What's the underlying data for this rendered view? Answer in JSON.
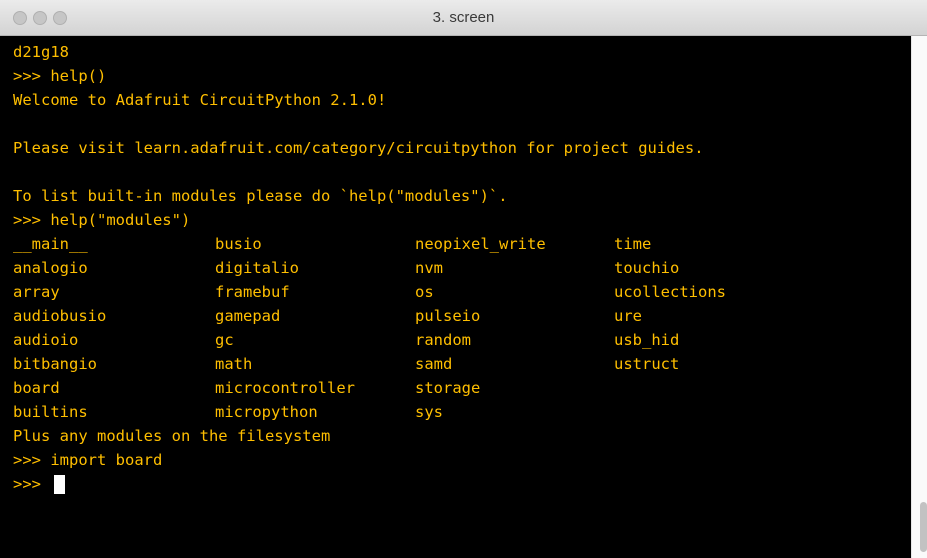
{
  "window": {
    "title": "3. screen"
  },
  "terminal": {
    "lines_top": [
      "d21g18",
      ">>> help()",
      "Welcome to Adafruit CircuitPython 2.1.0!",
      "",
      "Please visit learn.adafruit.com/category/circuitpython for project guides.",
      "",
      "To list built-in modules please do `help(\"modules\")`.",
      ">>> help(\"modules\")"
    ],
    "modules": [
      [
        "__main__",
        "busio",
        "neopixel_write",
        "time"
      ],
      [
        "analogio",
        "digitalio",
        "nvm",
        "touchio"
      ],
      [
        "array",
        "framebuf",
        "os",
        "ucollections"
      ],
      [
        "audiobusio",
        "gamepad",
        "pulseio",
        "ure"
      ],
      [
        "audioio",
        "gc",
        "random",
        "usb_hid"
      ],
      [
        "bitbangio",
        "math",
        "samd",
        "ustruct"
      ],
      [
        "board",
        "microcontroller",
        "storage",
        ""
      ],
      [
        "builtins",
        "micropython",
        "sys",
        ""
      ]
    ],
    "lines_bottom": [
      "Plus any modules on the filesystem",
      ">>> import board",
      ">>> "
    ]
  },
  "colors": {
    "text": "#ffbf00",
    "background": "#000000",
    "cursor": "#ffffff"
  }
}
